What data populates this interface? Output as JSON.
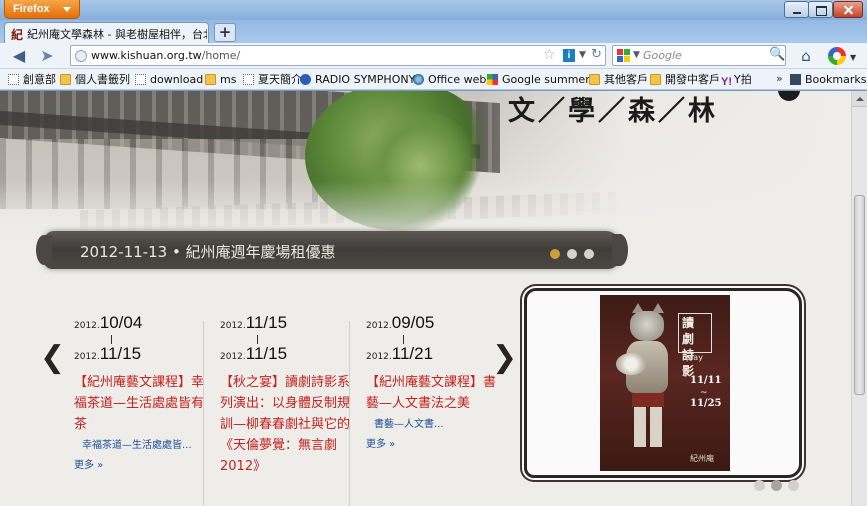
{
  "browser": {
    "app_button": "Firefox",
    "tab_title": "紀州庵文學森林 - 與老樹屋相伴，台北...",
    "url_host": "www.kishuan.org.tw",
    "url_path": "/home/",
    "search_placeholder": "Google"
  },
  "bookmarks": [
    {
      "label": "創意部",
      "icon": "page-icon"
    },
    {
      "label": "個人書籤列",
      "icon": "folder-icon"
    },
    {
      "label": "download",
      "icon": "page-icon"
    },
    {
      "label": "ms",
      "icon": "folder-icon"
    },
    {
      "label": "夏天簡介",
      "icon": "page-icon"
    },
    {
      "label": "RADIO SYMPHONY",
      "icon": "radio-icon"
    },
    {
      "label": "Office web",
      "icon": "office-icon"
    },
    {
      "label": "Google summers",
      "icon": "google-icon"
    },
    {
      "label": "其他客戶",
      "icon": "folder-icon"
    },
    {
      "label": "開發中客戶",
      "icon": "folder-icon"
    },
    {
      "label": "Y拍",
      "icon": "yahoo-icon"
    }
  ],
  "bookmarks_more": "»",
  "bookmarks_menu": "Bookmarks",
  "site": {
    "logo": "文／學／森／林",
    "news_headline": "2012-11-13 • 紀州庵週年慶場租優惠",
    "news": [
      {
        "from_year": "2012.",
        "from_md": "10/04",
        "to_year": "2012.",
        "to_md": "11/15",
        "title": "【紀州庵藝文課程】幸福茶道—生活處處皆有茶",
        "sub": "幸福茶道—生活處處皆...",
        "more": "更多 »"
      },
      {
        "from_year": "2012.",
        "from_md": "11/15",
        "to_year": "2012.",
        "to_md": "11/15",
        "title": "【秋之宴】讀劇詩影系列演出：以身體反制規訓—柳春春劇社與它的《天倫夢覺：無言劇2012》",
        "sub": "",
        "more": ""
      },
      {
        "from_year": "2012.",
        "from_md": "09/05",
        "to_year": "2012.",
        "to_md": "11/21",
        "title": "【紀州庵藝文課程】書藝—人文書法之美",
        "sub": "書藝—人文書...",
        "more": "更多 »"
      }
    ],
    "poster": {
      "title": "讀劇詩影",
      "subtitle": "play",
      "date_start": "11/11",
      "tilde": "~",
      "date_end": "11/25",
      "sign": "紀州庵"
    }
  }
}
